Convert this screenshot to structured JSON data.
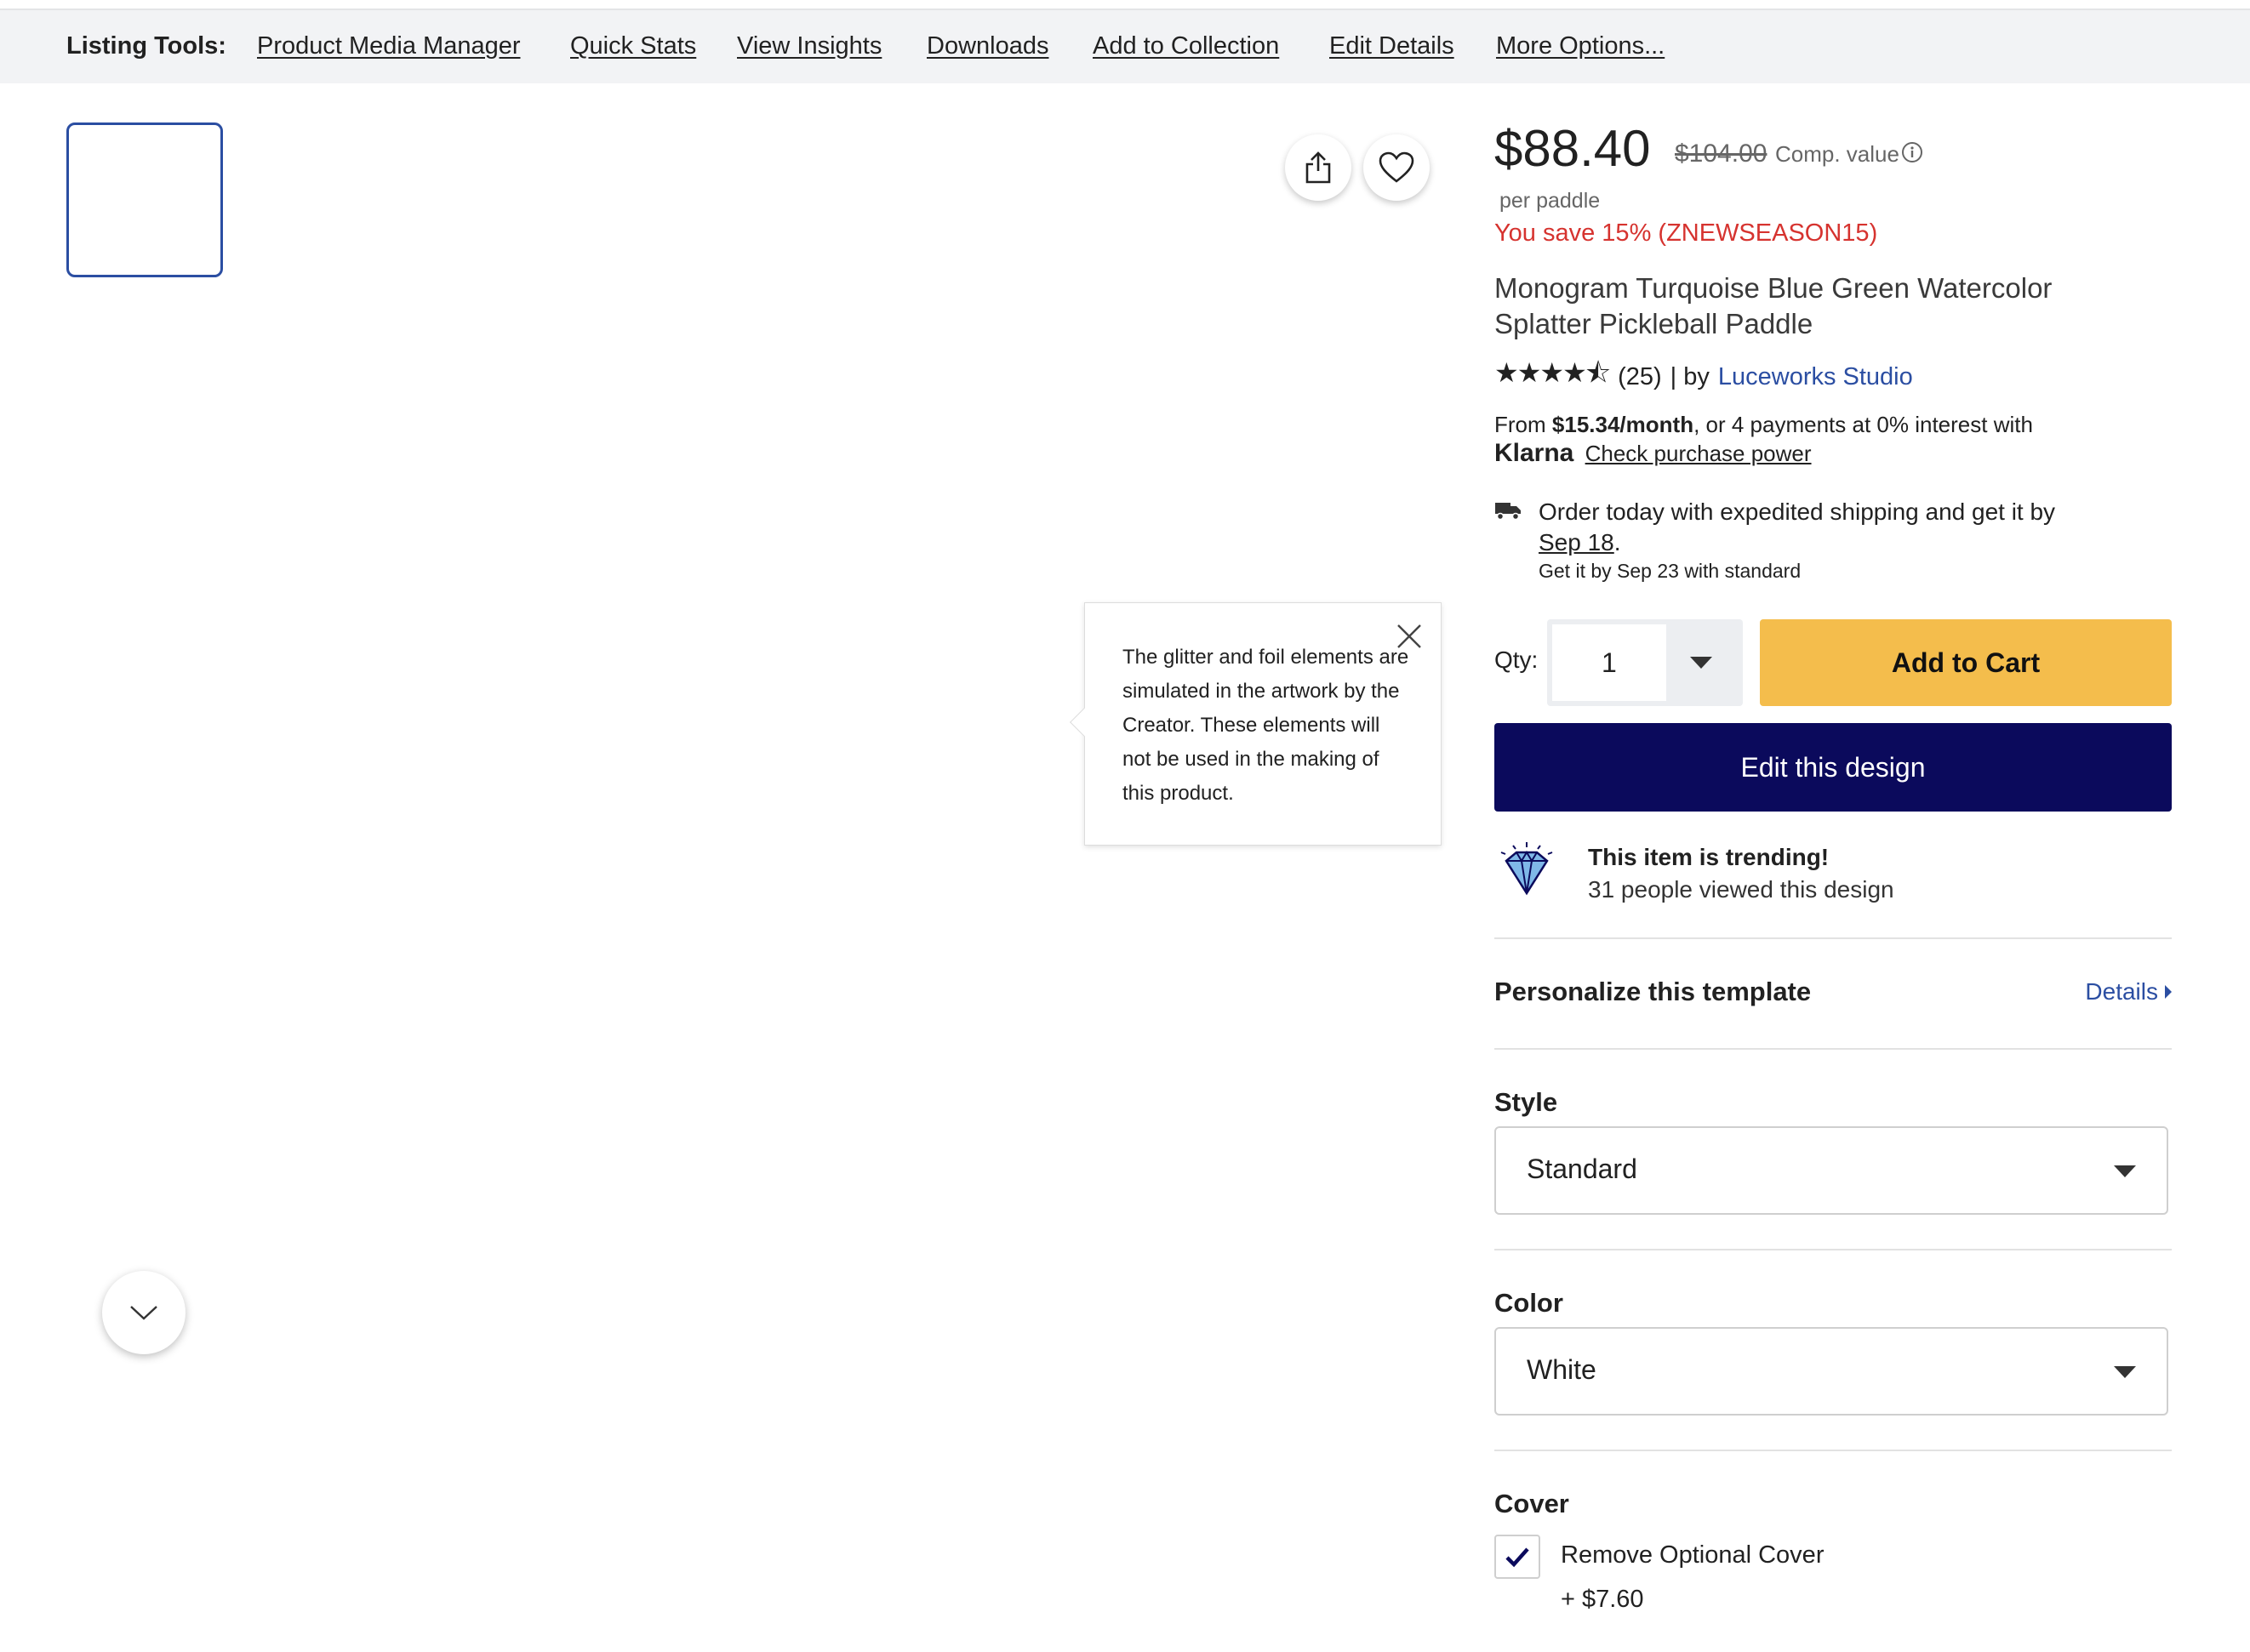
{
  "toolbar": {
    "label": "Listing Tools:",
    "links": [
      "Product Media Manager",
      "Quick Stats",
      "View Insights",
      "Downloads",
      "Add to Collection",
      "Edit Details",
      "More Options..."
    ]
  },
  "tooltip": {
    "text": "The glitter and foil elements are simulated in the artwork by the Creator. These elements will not be used in the making of this product."
  },
  "icons": {
    "share": "share-icon",
    "favorite": "heart-icon",
    "close": "close-icon",
    "info": "info-icon",
    "truck": "truck-icon",
    "gem": "diamond-icon",
    "scroll": "chevron-down-icon",
    "check": "check-icon"
  },
  "product": {
    "price": "$88.40",
    "comp_price": "$104.00",
    "comp_label": "Comp. value",
    "per": "per paddle",
    "savings": "You save 15% (ZNEWSEASON15)",
    "title": "Monogram Turquoise Blue Green Watercolor Splatter Pickleball Paddle",
    "rating_stars": 4.5,
    "rating_display": "★★★★⯪",
    "review_count": "(25)",
    "by_label": "| by",
    "creator": "Luceworks Studio"
  },
  "klarna": {
    "from": "From",
    "monthly": "$15.34/month",
    "rest": ", or 4 payments at 0% interest with",
    "brand": "Klarna",
    "link": "Check purchase power"
  },
  "shipping": {
    "line1_prefix": "Order today with expedited shipping and get it by",
    "date": "Sep 18",
    "period": ".",
    "line2": "Get it by Sep 23 with standard"
  },
  "purchase": {
    "qty_label": "Qty:",
    "qty_value": "1",
    "add_to_cart": "Add to Cart",
    "edit_design": "Edit this design"
  },
  "trending": {
    "title": "This item is trending!",
    "subtitle": "31 people viewed this design"
  },
  "personalize": {
    "title": "Personalize this template",
    "details_link": "Details"
  },
  "options": {
    "style_label": "Style",
    "style_value": "Standard",
    "color_label": "Color",
    "color_value": "White",
    "cover_label": "Cover",
    "cover_option": "Remove Optional Cover",
    "cover_price": "+ $7.60",
    "cover_checked": true
  },
  "colors": {
    "accent_blue": "#2b4ea2",
    "add_to_cart": "#f4bd4c",
    "edit_design": "#0b0a5c",
    "savings_red": "#d6332f"
  }
}
